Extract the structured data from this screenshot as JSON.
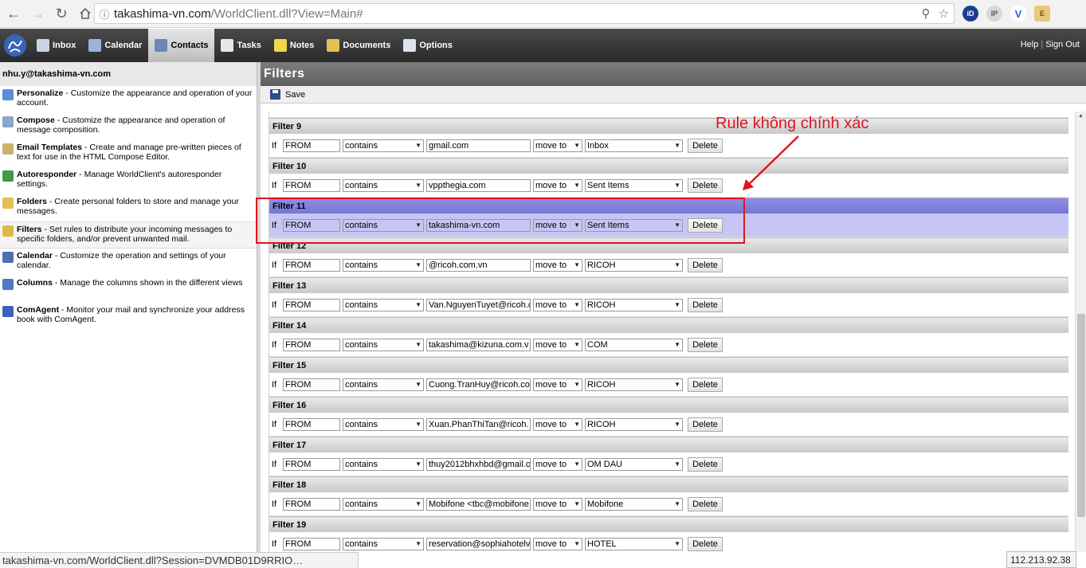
{
  "browser": {
    "url_domain": "takashima-vn.com",
    "url_path": "/WorldClient.dll?View=Main#",
    "ext_labels": [
      "iD",
      "IP",
      "V",
      "E"
    ]
  },
  "nav": {
    "items": [
      {
        "label": "Inbox",
        "icon": "inbox-icon"
      },
      {
        "label": "Calendar",
        "icon": "calendar-icon"
      },
      {
        "label": "Contacts",
        "icon": "contacts-icon",
        "active": true
      },
      {
        "label": "Tasks",
        "icon": "tasks-icon"
      },
      {
        "label": "Notes",
        "icon": "notes-icon"
      },
      {
        "label": "Documents",
        "icon": "documents-icon"
      },
      {
        "label": "Options",
        "icon": "options-icon"
      }
    ],
    "help": "Help",
    "signout": "Sign Out"
  },
  "sidebar": {
    "user": "nhu.y@takashima-vn.com",
    "items": [
      {
        "title": "Personalize",
        "desc": " - Customize the appearance and operation of your account.",
        "icon": "personalize-icon",
        "color": "#5a8fd6"
      },
      {
        "title": "Compose",
        "desc": " - Customize the appearance and operation of message composition.",
        "icon": "compose-icon",
        "color": "#8aa6c8"
      },
      {
        "title": "Email Templates",
        "desc": " - Create and manage pre-written pieces of text for use in the HTML Compose Editor.",
        "icon": "template-icon",
        "color": "#c9b26a"
      },
      {
        "title": "Autoresponder",
        "desc": " - Manage WorldClient's autoresponder settings.",
        "icon": "autoresponder-icon",
        "color": "#3f9a4a"
      },
      {
        "title": "Folders",
        "desc": " - Create personal folders to store and manage your messages.",
        "icon": "folder-icon",
        "color": "#e3c052"
      },
      {
        "title": "Filters",
        "desc": " - Set rules to distribute your incoming messages to specific folders, and/or prevent unwanted mail.",
        "icon": "filter-icon",
        "color": "#e0b844",
        "active": true
      },
      {
        "title": "Calendar",
        "desc": " - Customize the operation and settings of your calendar.",
        "icon": "calendar-icon",
        "color": "#4f6fb0"
      },
      {
        "title": "Columns",
        "desc": " - Manage the columns shown in the different views",
        "icon": "columns-icon",
        "color": "#4c7cc4"
      },
      {
        "title": "ComAgent",
        "desc": " - Monitor your mail and synchronize your address book with ComAgent.",
        "icon": "comagent-icon",
        "color": "#3b63b8"
      }
    ]
  },
  "main": {
    "title": "Filters",
    "save_label": "Save",
    "if_label": "If",
    "delete_label": "Delete",
    "filters": [
      {
        "name": "Filter 9",
        "field": "FROM",
        "cond": "contains",
        "value": "gmail.com",
        "action": "move to",
        "folder": "Inbox"
      },
      {
        "name": "Filter 10",
        "field": "FROM",
        "cond": "contains",
        "value": "vppthegia.com",
        "action": "move to",
        "folder": "Sent Items"
      },
      {
        "name": "Filter 11",
        "field": "FROM",
        "cond": "contains",
        "value": "takashima-vn.com",
        "action": "move to",
        "folder": "Sent Items",
        "highlight": true
      },
      {
        "name": "Filter 12",
        "field": "FROM",
        "cond": "contains",
        "value": "@ricoh.com.vn",
        "action": "move to",
        "folder": "RICOH"
      },
      {
        "name": "Filter 13",
        "field": "FROM",
        "cond": "contains",
        "value": "Van.NguyenTuyet@ricoh.c",
        "action": "move to",
        "folder": "RICOH"
      },
      {
        "name": "Filter 14",
        "field": "FROM",
        "cond": "contains",
        "value": "takashima@kizuna.com.v",
        "action": "move to",
        "folder": "COM"
      },
      {
        "name": "Filter 15",
        "field": "FROM",
        "cond": "contains",
        "value": "Cuong.TranHuy@ricoh.co",
        "action": "move to",
        "folder": "RICOH"
      },
      {
        "name": "Filter 16",
        "field": "FROM",
        "cond": "contains",
        "value": "Xuan.PhanThiTan@ricoh.",
        "action": "move to",
        "folder": "RICOH"
      },
      {
        "name": "Filter 17",
        "field": "FROM",
        "cond": "contains",
        "value": "thuy2012bhxhbd@gmail.c",
        "action": "move to",
        "folder": "OM DAU"
      },
      {
        "name": "Filter 18",
        "field": "FROM",
        "cond": "contains",
        "value": "Mobifone <tbc@mobifone",
        "action": "move to",
        "folder": "Mobifone"
      },
      {
        "name": "Filter 19",
        "field": "FROM",
        "cond": "contains",
        "value": "reservation@sophiahotelv",
        "action": "move to",
        "folder": "HOTEL"
      }
    ]
  },
  "annotation": {
    "text": "Rule không chính xác",
    "color": "#e0141e"
  },
  "status": {
    "url": "takashima-vn.com/WorldClient.dll?Session=DVMDB01D9RRIO…",
    "ip": "112.213.92.38"
  }
}
